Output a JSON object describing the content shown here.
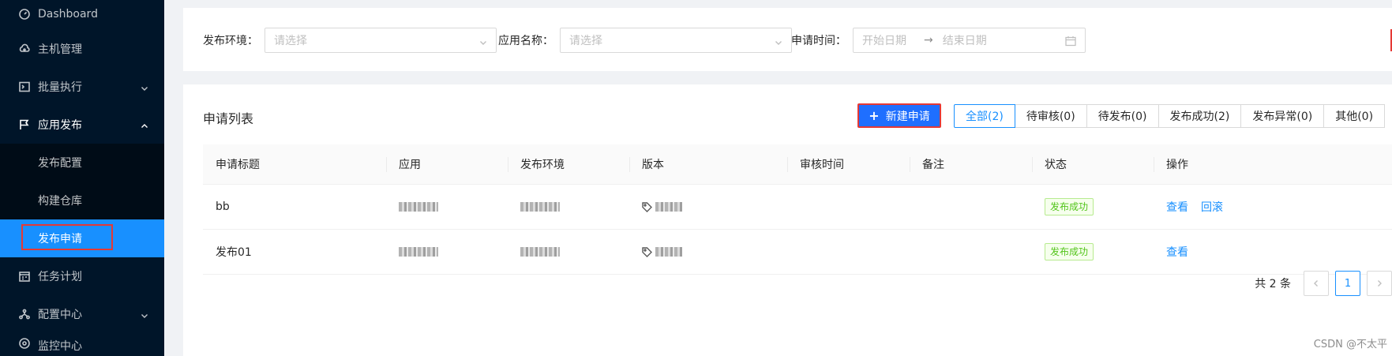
{
  "sidebar": {
    "items": [
      {
        "label": "Dashboard",
        "icon": "dashboard-icon"
      },
      {
        "label": "主机管理",
        "icon": "cloud-server-icon"
      },
      {
        "label": "批量执行",
        "icon": "terminal-icon",
        "expanded": false
      },
      {
        "label": "应用发布",
        "icon": "flag-icon",
        "expanded": true
      },
      {
        "label": "任务计划",
        "icon": "schedule-icon"
      },
      {
        "label": "配置中心",
        "icon": "cluster-icon",
        "expanded": false
      },
      {
        "label": "监控中心",
        "icon": "monitor-icon"
      }
    ],
    "submenu": [
      {
        "label": "发布配置"
      },
      {
        "label": "构建仓库"
      },
      {
        "label": "发布申请",
        "selected": true
      }
    ]
  },
  "filters": {
    "env_label": "发布环境：",
    "env_placeholder": "请选择",
    "app_label": "应用名称：",
    "app_placeholder": "请选择",
    "time_label": "申请时间：",
    "start_placeholder": "开始日期",
    "end_placeholder": "结束日期",
    "separator": "→"
  },
  "main": {
    "title": "申请列表",
    "new_button": "新建申请",
    "tabs": [
      {
        "label": "全部(2)",
        "active": true
      },
      {
        "label": "待审核(0)"
      },
      {
        "label": "待发布(0)"
      },
      {
        "label": "发布成功(2)"
      },
      {
        "label": "发布异常(0)"
      },
      {
        "label": "其他(0)"
      }
    ],
    "columns": [
      "申请标题",
      "应用",
      "发布环境",
      "版本",
      "审核时间",
      "备注",
      "状态",
      "操作"
    ],
    "rows": [
      {
        "title": "bb",
        "status": "发布成功",
        "actions": [
          "查看",
          "回滚"
        ]
      },
      {
        "title": "发布01",
        "status": "发布成功",
        "actions": [
          "查看"
        ]
      }
    ],
    "pagination": {
      "total": "共 2 条",
      "current": "1"
    }
  },
  "watermark": "CSDN @不太平",
  "colors": {
    "primary": "#1890ff",
    "sidebar": "#001529",
    "success": "#52c41a",
    "highlight": "#e53935"
  }
}
